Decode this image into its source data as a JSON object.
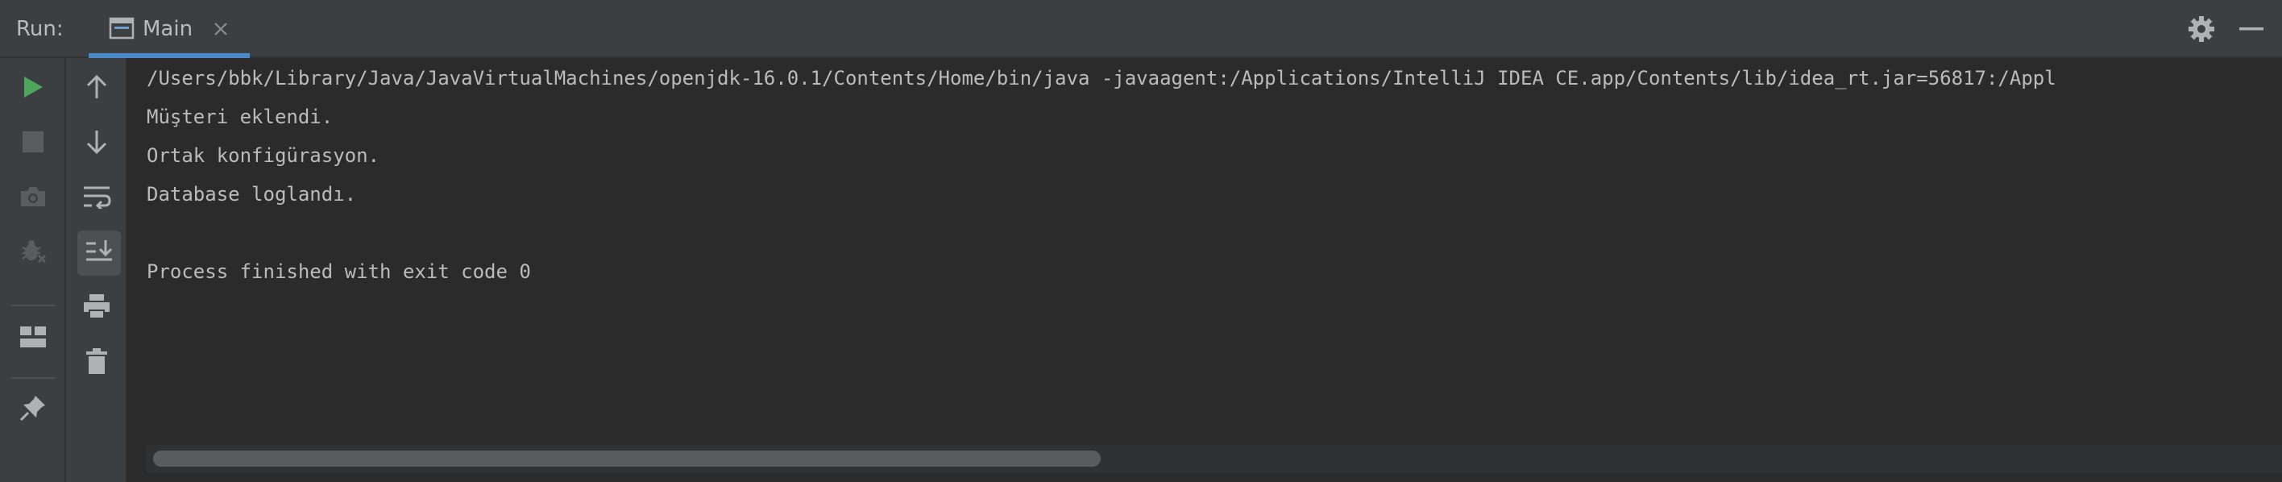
{
  "header": {
    "run_label": "Run:",
    "tab_label": "Main"
  },
  "icons": {
    "tab": "console-window-icon",
    "tab_close": "close-icon",
    "settings": "gear-icon",
    "hide": "minimize-icon",
    "rerun": "run-icon",
    "stop": "stop-icon",
    "snapshot": "camera-icon",
    "debug": "debug-icon",
    "layout": "layout-icon",
    "pin": "pin-icon",
    "up": "arrow-up-icon",
    "down": "arrow-down-icon",
    "wrap": "soft-wrap-icon",
    "scroll_end": "scroll-to-end-icon",
    "print": "print-icon",
    "clear": "trash-icon"
  },
  "colors": {
    "run_green": "#4fa55b",
    "tab_underline": "#4a88c7",
    "text": "#bbbbbb"
  },
  "console": {
    "lines": [
      "/Users/bbk/Library/Java/JavaVirtualMachines/openjdk-16.0.1/Contents/Home/bin/java -javaagent:/Applications/IntelliJ IDEA CE.app/Contents/lib/idea_rt.jar=56817:/Appl",
      "Müşteri eklendi.",
      "Ortak konfigürasyon.",
      "Database loglandı.",
      "",
      "Process finished with exit code 0"
    ]
  }
}
